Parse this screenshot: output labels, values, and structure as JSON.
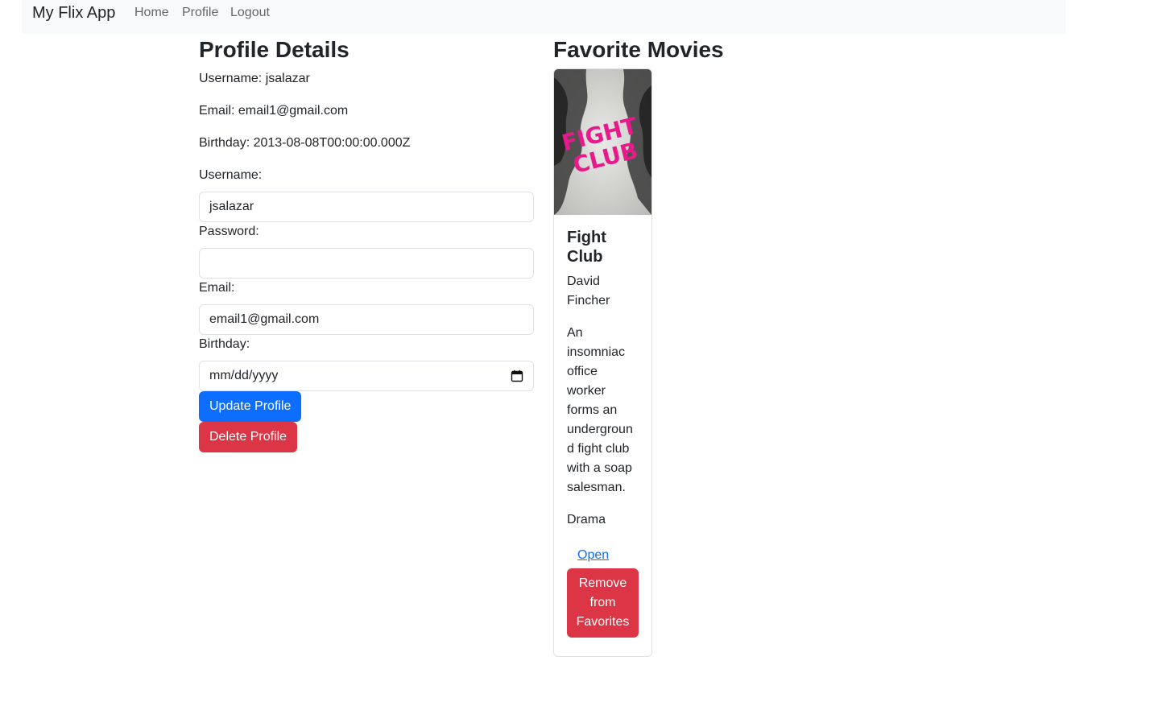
{
  "navbar": {
    "brand": "My Flix App",
    "links": [
      "Home",
      "Profile",
      "Logout"
    ]
  },
  "profile": {
    "title": "Profile Details",
    "username_line": "Username: jsalazar",
    "email_line": "Email: email1@gmail.com",
    "birthday_line": "Birthday: 2013-08-08T00:00:00.000Z",
    "form": {
      "username_label": "Username:",
      "username_value": "jsalazar",
      "password_label": "Password:",
      "password_value": "",
      "email_label": "Email:",
      "email_value": "email1@gmail.com",
      "birthday_label": "Birthday:",
      "birthday_placeholder": "mm/dd/yyyy",
      "update_label": "Update Profile",
      "delete_label": "Delete Profile"
    }
  },
  "favorites": {
    "title": "Favorite Movies",
    "movies": [
      {
        "poster_text": "FIGHT CLUB",
        "title_line1": "Fight",
        "title_line2": "Club",
        "director_line1": "David",
        "director_line2": "Fincher",
        "description_lines": [
          "An",
          "insomniac",
          "office",
          "worker",
          "forms an",
          "undergroun",
          "d fight club",
          "with a soap",
          "salesman."
        ],
        "genre": "Drama",
        "open_label": "Open",
        "remove_lines": [
          "Remove",
          "from",
          "Favorites"
        ]
      }
    ]
  },
  "colors": {
    "primary": "#0d6efd",
    "danger": "#dc3545",
    "navbar_bg": "#f8f9fa",
    "poster_pink": "#e8198a"
  }
}
